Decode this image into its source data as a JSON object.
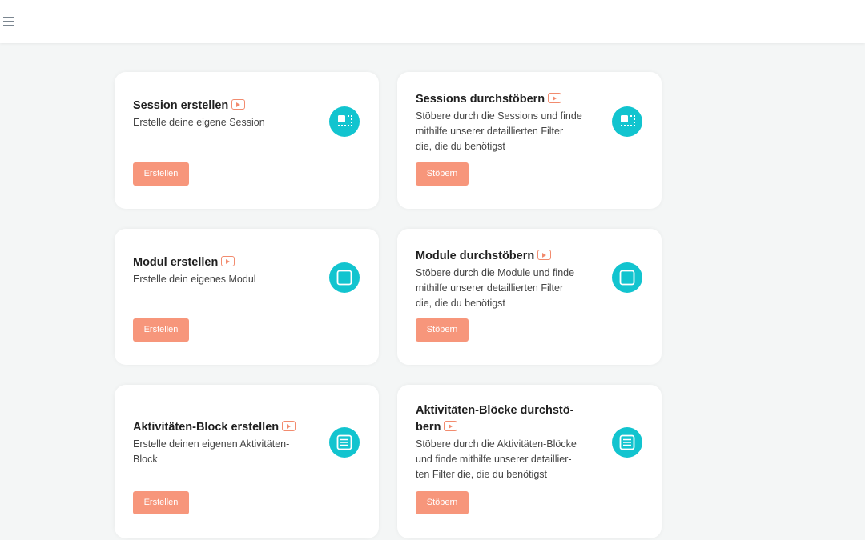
{
  "header": {
    "menu_icon": "hamburger-menu-icon"
  },
  "accent_colors": {
    "button": "#f7967b",
    "icon_circle": "#12c4cf",
    "play_icon": "#f28b6e"
  },
  "cards": [
    {
      "title": "Session erstellen",
      "desc_lines": [
        "Erstelle deine eigene Session"
      ],
      "button": "Erstellen",
      "icon": "session-icon"
    },
    {
      "title": "Sessions durchstöbern",
      "desc_lines": [
        "Stöbere durch die Sessions und finde",
        "mithilfe unserer detaillierten Filter",
        "die, die du benötigst"
      ],
      "button": "Stöbern",
      "icon": "session-icon"
    },
    {
      "title": "Modul erstellen",
      "desc_lines": [
        "Erstelle dein eigenes Modul"
      ],
      "button": "Erstellen",
      "icon": "module-icon"
    },
    {
      "title": "Module durchstöbern",
      "desc_lines": [
        "Stöbere durch die Module und finde",
        "mithilfe unserer detaillierten Filter",
        "die, die du benötigst"
      ],
      "button": "Stöbern",
      "icon": "module-icon"
    },
    {
      "title": "Aktivitäten-Block erstellen",
      "desc_lines": [
        "Erstelle deinen eigenen Aktivitäten-",
        "Block"
      ],
      "button": "Erstellen",
      "icon": "activity-block-icon"
    },
    {
      "title_lines": [
        "Aktivitäten-Blöcke durchstö-",
        "bern"
      ],
      "desc_lines": [
        "Stöbere durch die Aktivitäten-Blöcke",
        "und finde mithilfe unserer detaillier-",
        "ten Filter die, die du benötigst"
      ],
      "button": "Stöbern",
      "icon": "activity-block-icon"
    }
  ]
}
